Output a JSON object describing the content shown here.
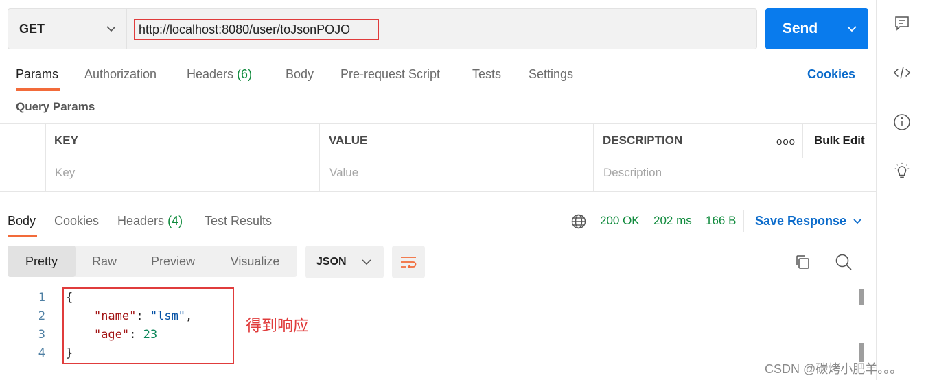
{
  "request": {
    "method": "GET",
    "url": "http://localhost:8080/user/toJsonPOJO",
    "send_label": "Send"
  },
  "request_tabs": [
    {
      "label": "Params",
      "count": ""
    },
    {
      "label": "Authorization",
      "count": ""
    },
    {
      "label": "Headers",
      "count": "(6)"
    },
    {
      "label": "Body",
      "count": ""
    },
    {
      "label": "Pre-request Script",
      "count": ""
    },
    {
      "label": "Tests",
      "count": ""
    },
    {
      "label": "Settings",
      "count": ""
    }
  ],
  "cookies_label": "Cookies",
  "query_params": {
    "title": "Query Params",
    "columns": [
      "KEY",
      "VALUE",
      "DESCRIPTION"
    ],
    "bulk_edit": "Bulk Edit",
    "more": "ooo",
    "placeholders": [
      "Key",
      "Value",
      "Description"
    ]
  },
  "response_tabs": [
    {
      "label": "Body",
      "count": ""
    },
    {
      "label": "Cookies",
      "count": ""
    },
    {
      "label": "Headers",
      "count": "(4)"
    },
    {
      "label": "Test Results",
      "count": ""
    }
  ],
  "response_status": {
    "status": "200 OK",
    "time": "202 ms",
    "size": "166 B",
    "save_label": "Save Response"
  },
  "view_modes": [
    "Pretty",
    "Raw",
    "Preview",
    "Visualize"
  ],
  "format": "JSON",
  "code": {
    "line_numbers": [
      "1",
      "2",
      "3",
      "4"
    ],
    "open_brace": "{",
    "key1": "\"name\"",
    "sep1": ": ",
    "val1": "\"lsm\"",
    "comma": ",",
    "key2": "\"age\"",
    "sep2": ": ",
    "val2": "23",
    "close_brace": "}"
  },
  "annotation": "得到响应",
  "watermark": "CSDN @碳烤小肥羊。。。",
  "colors": {
    "accent": "#097bed",
    "tab_underline": "#f26b3a",
    "highlight_box": "#e03c3c",
    "success": "#0f8a3c",
    "link": "#0b6bcb"
  },
  "icons": [
    "chevron-down-icon",
    "globe-icon",
    "wrap-lines-icon",
    "copy-icon",
    "search-icon",
    "comment-icon",
    "code-icon",
    "info-icon",
    "lightbulb-icon"
  ]
}
